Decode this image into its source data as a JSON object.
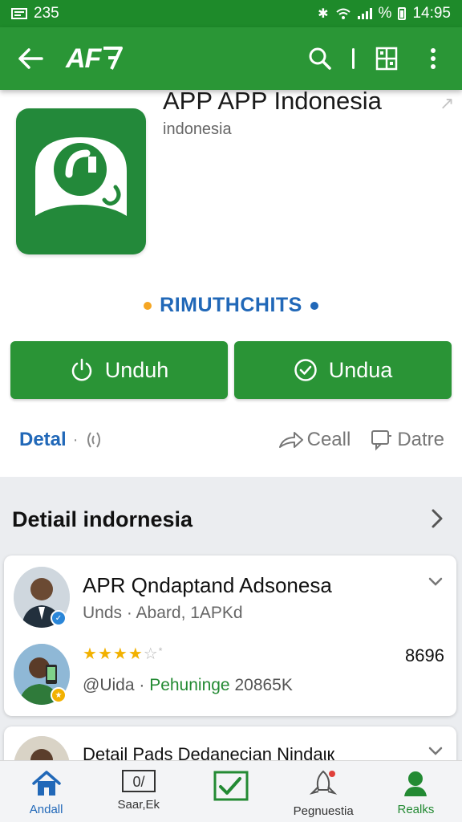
{
  "status": {
    "left_text": "235",
    "battery_pct": "%",
    "time": "14:95"
  },
  "appbar": {
    "logo": "AF"
  },
  "app": {
    "title": "APP APP Indonesia",
    "subtitle": "indonesia",
    "brand": "RIMUTHCHITS"
  },
  "buttons": {
    "download_left": "Unduh",
    "download_right": "Undua"
  },
  "actions": {
    "detail": "Detal",
    "call": "Ceall",
    "date": "Datre"
  },
  "section": {
    "title": "Detiail indornesia",
    "card": {
      "title": "APR Qndaptand Adsonesa",
      "subtitle": "Unds · Abard, 1APKd",
      "rating": 4,
      "rating_max": 5,
      "count": "8696",
      "meta_prefix": "@Uida ·",
      "meta_green": "Pehuninge",
      "meta_suffix": "20865K"
    },
    "peek_title": "Detail Pads Dedanecian Nindaιк"
  },
  "nav": [
    {
      "label": "Andall"
    },
    {
      "label": "Saar,Ek"
    },
    {
      "label": ""
    },
    {
      "label": "Pegnuestia"
    },
    {
      "label": "Realks"
    }
  ],
  "colors": {
    "primary": "#2a9636",
    "statusbar": "#1e8a2a",
    "accent": "#2168b8",
    "star": "#f2b100",
    "dot_orange": "#f5a623"
  }
}
